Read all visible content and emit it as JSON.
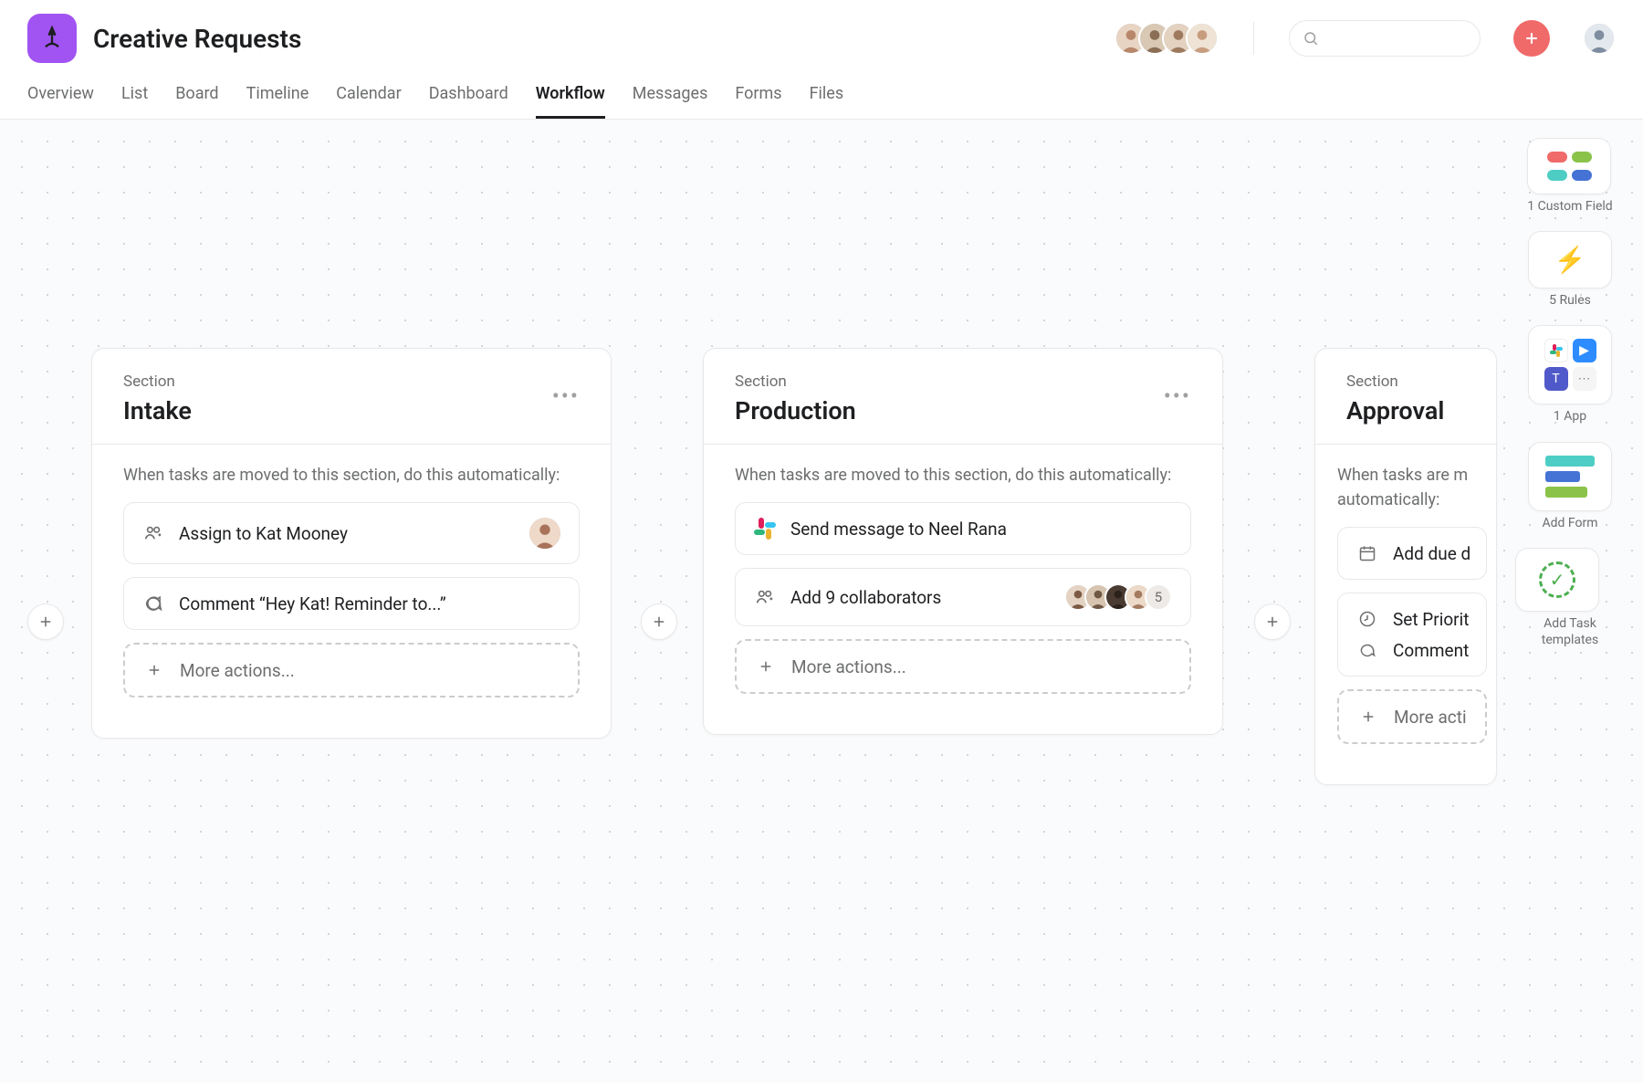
{
  "project": {
    "title": "Creative Requests"
  },
  "tabs": [
    "Overview",
    "List",
    "Board",
    "Timeline",
    "Calendar",
    "Dashboard",
    "Workflow",
    "Messages",
    "Forms",
    "Files"
  ],
  "activeTab": "Workflow",
  "header": {
    "memberCount": 4,
    "searchPlaceholder": ""
  },
  "canvas": {
    "sectionLabel": "Section",
    "ruleIntro": "When tasks are moved to this section, do this automatically:",
    "moreActions": "More actions...",
    "sections": [
      {
        "name": "Intake",
        "rules": [
          {
            "kind": "assign",
            "text": "Assign to Kat Mooney"
          },
          {
            "kind": "comment",
            "text": "Comment “Hey Kat! Reminder to...”"
          }
        ]
      },
      {
        "name": "Production",
        "rules": [
          {
            "kind": "slack",
            "text": "Send message to Neel Rana"
          },
          {
            "kind": "collab",
            "text": "Add 9 collaborators",
            "overflow": "5",
            "shownAvatars": 4
          }
        ]
      },
      {
        "name": "Approval",
        "rules": [
          {
            "kind": "date",
            "text": "Add due d"
          },
          {
            "kind": "priority",
            "text": "Set Priorit"
          },
          {
            "kind": "comment",
            "text": "Comment"
          }
        ],
        "moreActionsShort": "More acti"
      }
    ]
  },
  "toolRail": {
    "customFields": {
      "label": "1 Custom Field"
    },
    "rules": {
      "label": "5 Rules"
    },
    "apps": {
      "label": "1 App"
    },
    "form": {
      "label": "Add Form"
    },
    "templates": {
      "label": "Add Task templates"
    }
  }
}
